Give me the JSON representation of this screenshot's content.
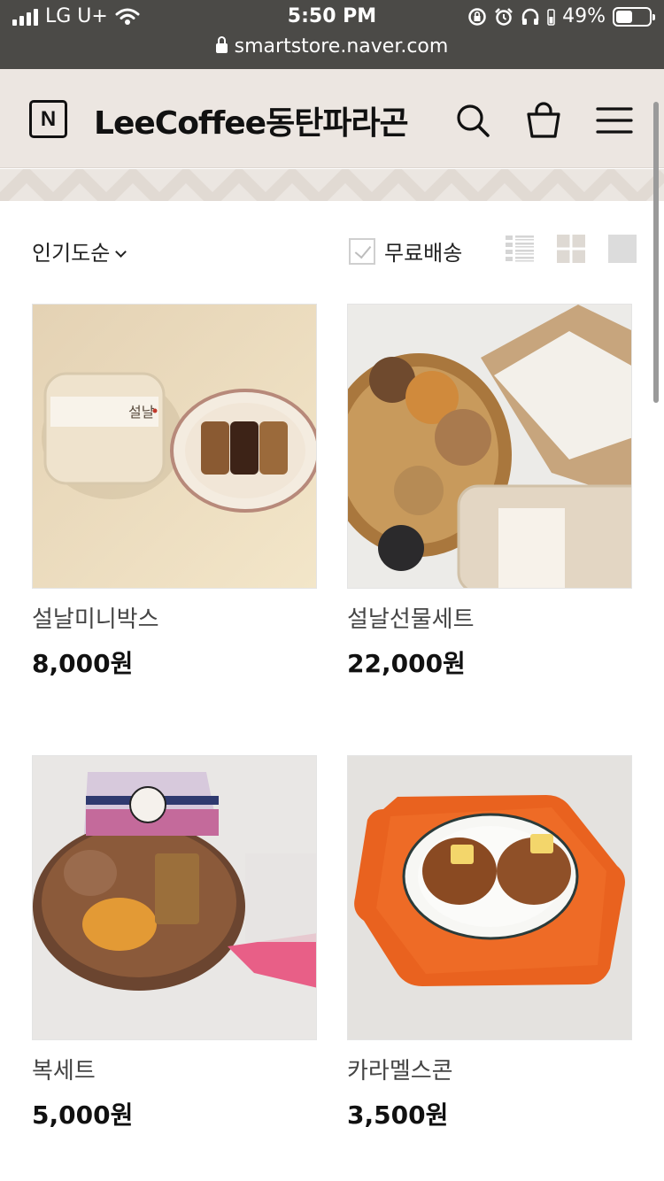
{
  "status_bar": {
    "carrier": "LG U+",
    "time": "5:50 PM",
    "battery": "49%",
    "battery_level": 0.49,
    "url": "smartstore.naver.com"
  },
  "header": {
    "logo_letter": "N",
    "store_name": "LeeCoffee동탄파라곤"
  },
  "filters": {
    "sort_label": "인기도순",
    "free_shipping_label": "무료배송",
    "free_shipping_checked": false
  },
  "products": [
    {
      "name": "설날미니박스",
      "price": "8,000원"
    },
    {
      "name": "설날선물세트",
      "price": "22,000원"
    },
    {
      "name": "복세트",
      "price": "5,000원"
    },
    {
      "name": "카라멜스콘",
      "price": "3,500원"
    }
  ],
  "icons": {
    "search": "search-icon",
    "cart": "shopping-bag-icon",
    "menu": "hamburger-menu-icon",
    "list_view": "list-view-icon",
    "grid_view": "grid-view-icon",
    "large_view": "large-view-icon"
  },
  "colors": {
    "status_bar_bg": "#4b4a47",
    "header_bg": "#ece6e1",
    "accent_orange": "#e9621f"
  }
}
